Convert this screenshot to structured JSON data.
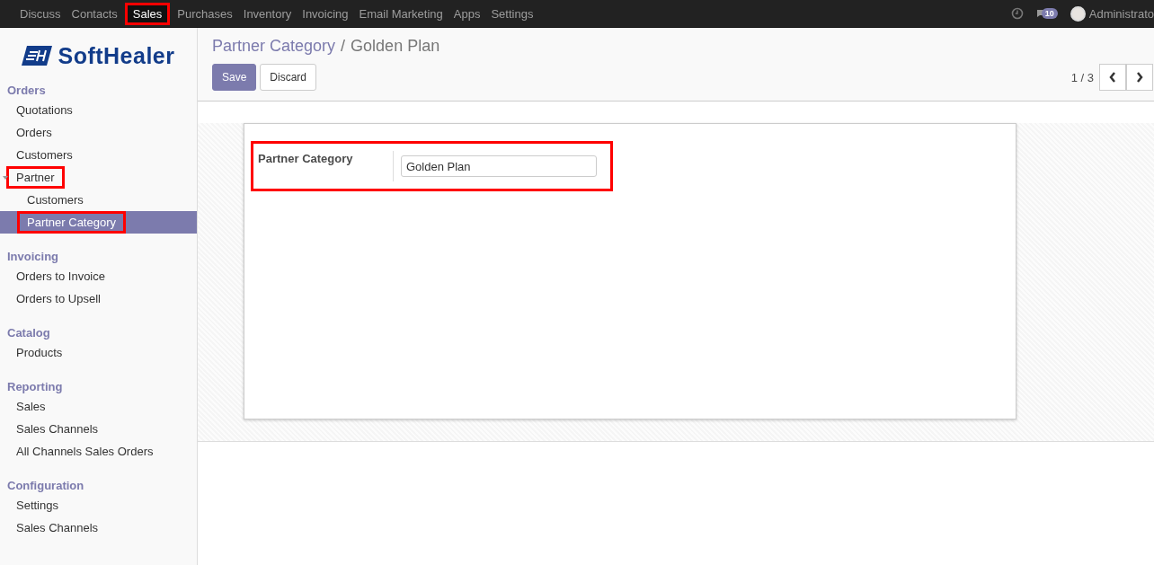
{
  "top_menu": [
    {
      "label": "Discuss",
      "selected": false,
      "highlighted": false
    },
    {
      "label": "Contacts",
      "selected": false,
      "highlighted": false
    },
    {
      "label": "Sales",
      "selected": true,
      "highlighted": true
    },
    {
      "label": "Purchases",
      "selected": false,
      "highlighted": false
    },
    {
      "label": "Inventory",
      "selected": false,
      "highlighted": false
    },
    {
      "label": "Invoicing",
      "selected": false,
      "highlighted": false
    },
    {
      "label": "Email Marketing",
      "selected": false,
      "highlighted": false
    },
    {
      "label": "Apps",
      "selected": false,
      "highlighted": false
    },
    {
      "label": "Settings",
      "selected": false,
      "highlighted": false
    }
  ],
  "systray": {
    "message_count": "10",
    "user": "Administrato"
  },
  "logo": {
    "text": "SoftHealer"
  },
  "sidebar": {
    "sections": [
      {
        "title": "Orders",
        "items": [
          {
            "label": "Quotations",
            "selected": false,
            "highlighted": false
          },
          {
            "label": "Orders",
            "selected": false,
            "highlighted": false
          },
          {
            "label": "Customers",
            "selected": false,
            "highlighted": false
          },
          {
            "label": "Partner",
            "selected": false,
            "highlighted": true,
            "expanded": true,
            "children": [
              {
                "label": "Customers",
                "selected": false,
                "highlighted": false
              },
              {
                "label": "Partner Category",
                "selected": true,
                "highlighted": true
              }
            ]
          }
        ]
      },
      {
        "title": "Invoicing",
        "items": [
          {
            "label": "Orders to Invoice",
            "selected": false,
            "highlighted": false
          },
          {
            "label": "Orders to Upsell",
            "selected": false,
            "highlighted": false
          }
        ]
      },
      {
        "title": "Catalog",
        "items": [
          {
            "label": "Products",
            "selected": false,
            "highlighted": false
          }
        ]
      },
      {
        "title": "Reporting",
        "items": [
          {
            "label": "Sales",
            "selected": false,
            "highlighted": false
          },
          {
            "label": "Sales Channels",
            "selected": false,
            "highlighted": false
          },
          {
            "label": "All Channels Sales Orders",
            "selected": false,
            "highlighted": false
          }
        ]
      },
      {
        "title": "Configuration",
        "items": [
          {
            "label": "Settings",
            "selected": false,
            "highlighted": false
          },
          {
            "label": "Sales Channels",
            "selected": false,
            "highlighted": false
          }
        ]
      }
    ]
  },
  "breadcrumb": {
    "parent": "Partner Category",
    "separator": "/",
    "current": "Golden Plan"
  },
  "buttons": [
    {
      "label": "Save",
      "kind": "primary"
    },
    {
      "label": "Discard",
      "kind": "secondary"
    }
  ],
  "pager": {
    "value": "1 / 3"
  },
  "form": {
    "field": {
      "label": "Partner Category",
      "value": "Golden Plan",
      "highlighted": true
    }
  }
}
